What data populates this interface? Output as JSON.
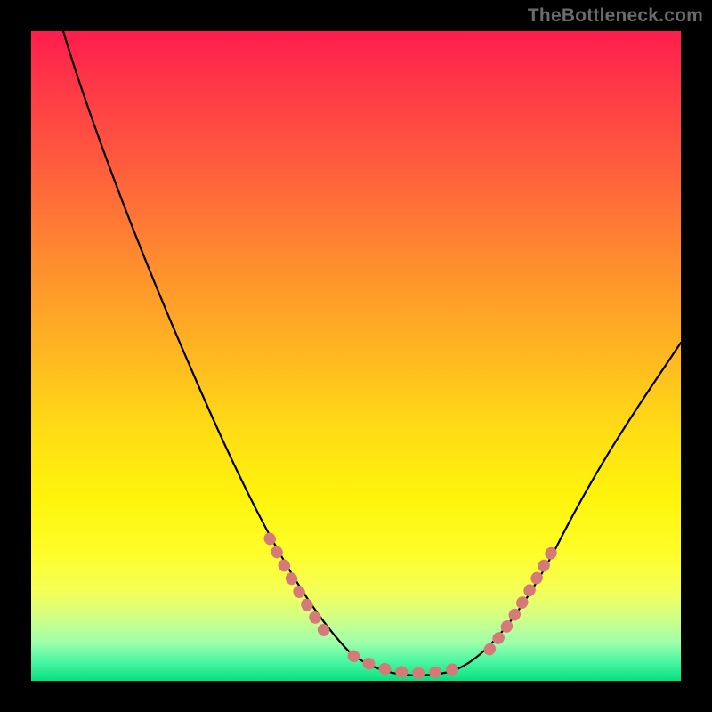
{
  "watermark": "TheBottleneck.com",
  "chart_data": {
    "type": "line",
    "title": "",
    "xlabel": "",
    "ylabel": "",
    "xlim": [
      0,
      100
    ],
    "ylim": [
      0,
      100
    ],
    "grid": false,
    "legend": false,
    "series": [
      {
        "name": "bottleneck-curve",
        "stroke": "#000000",
        "x": [
          5,
          10,
          15,
          20,
          25,
          30,
          35,
          40,
          45,
          50,
          55,
          57,
          60,
          63,
          66,
          70,
          75,
          80,
          85,
          90,
          95,
          100
        ],
        "values": [
          100,
          89,
          79,
          69,
          59,
          49,
          39,
          30,
          21,
          13,
          6,
          4,
          2,
          1,
          1,
          2,
          6,
          13,
          22,
          32,
          42,
          52
        ]
      },
      {
        "name": "marker-band",
        "type": "scatter",
        "stroke": "#d57a78",
        "x": [
          40,
          41,
          42,
          43,
          44,
          45,
          50,
          53,
          56,
          58,
          60,
          62,
          64,
          66,
          68,
          70,
          71,
          72,
          73,
          74,
          75,
          76,
          77
        ],
        "values": [
          30,
          28,
          26,
          24,
          23,
          21,
          13,
          8,
          5,
          3,
          2,
          1,
          1,
          1,
          1.5,
          2,
          3,
          4,
          5,
          6,
          7,
          8.5,
          10
        ]
      }
    ],
    "background_gradient": {
      "top": "#ff1c4d",
      "mid_upper": "#ff8b2f",
      "mid": "#ffde14",
      "mid_lower": "#fffd28",
      "bottom": "#06e07e"
    },
    "notes": "V-shaped bottleneck curve over rainbow gradient; thick salmon marker segments overlay parts of the curve near the valley and on both flanks."
  }
}
